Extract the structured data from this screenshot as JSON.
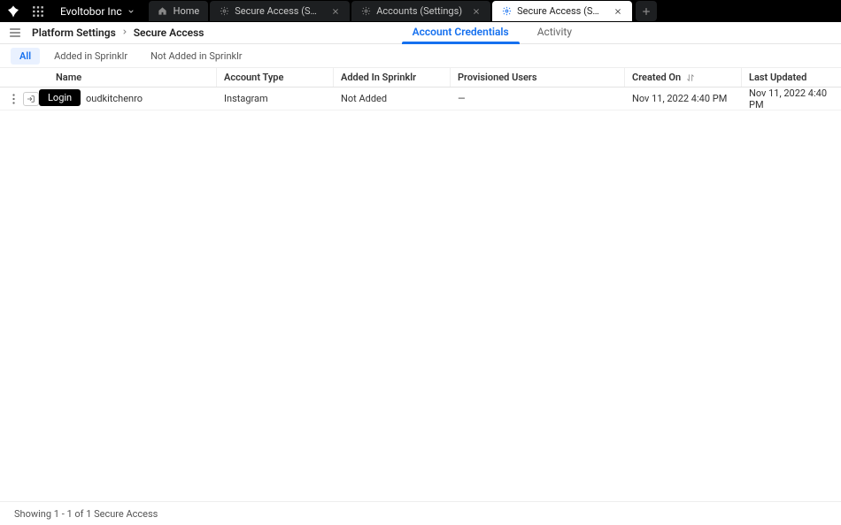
{
  "org_name": "Evoltobor Inc",
  "top_tabs": [
    {
      "label": "Home",
      "icon": "home",
      "closeable": false,
      "active": false
    },
    {
      "label": "Secure Access (Settings)",
      "icon": "gear",
      "closeable": true,
      "active": false
    },
    {
      "label": "Accounts (Settings)",
      "icon": "gear",
      "closeable": true,
      "active": false
    },
    {
      "label": "Secure Access (Settings)",
      "icon": "gear",
      "closeable": true,
      "active": true
    }
  ],
  "breadcrumb": {
    "crumb1": "Platform Settings",
    "crumb2": "Secure Access"
  },
  "sub_tabs": {
    "items": [
      "Account Credentials",
      "Activity"
    ],
    "active_index": 0
  },
  "filters": {
    "items": [
      "All",
      "Added in Sprinklr",
      "Not Added in Sprinklr"
    ],
    "active_index": 0
  },
  "table": {
    "columns": [
      "Name",
      "Account Type",
      "Added In Sprinklr",
      "Provisioned Users",
      "Created On",
      "Last Updated"
    ],
    "sort_column_index": 4,
    "rows": [
      {
        "name": "oudkitchenro",
        "account_type": "Instagram",
        "added_in_sprinklr": "Not Added",
        "provisioned_users": "—",
        "created_on": "Nov 11, 2022 4:40 PM",
        "last_updated": "Nov 11, 2022 4:40 PM"
      }
    ]
  },
  "tooltip": {
    "login": "Login"
  },
  "footer": {
    "status": "Showing 1 - 1 of 1 Secure Access"
  }
}
